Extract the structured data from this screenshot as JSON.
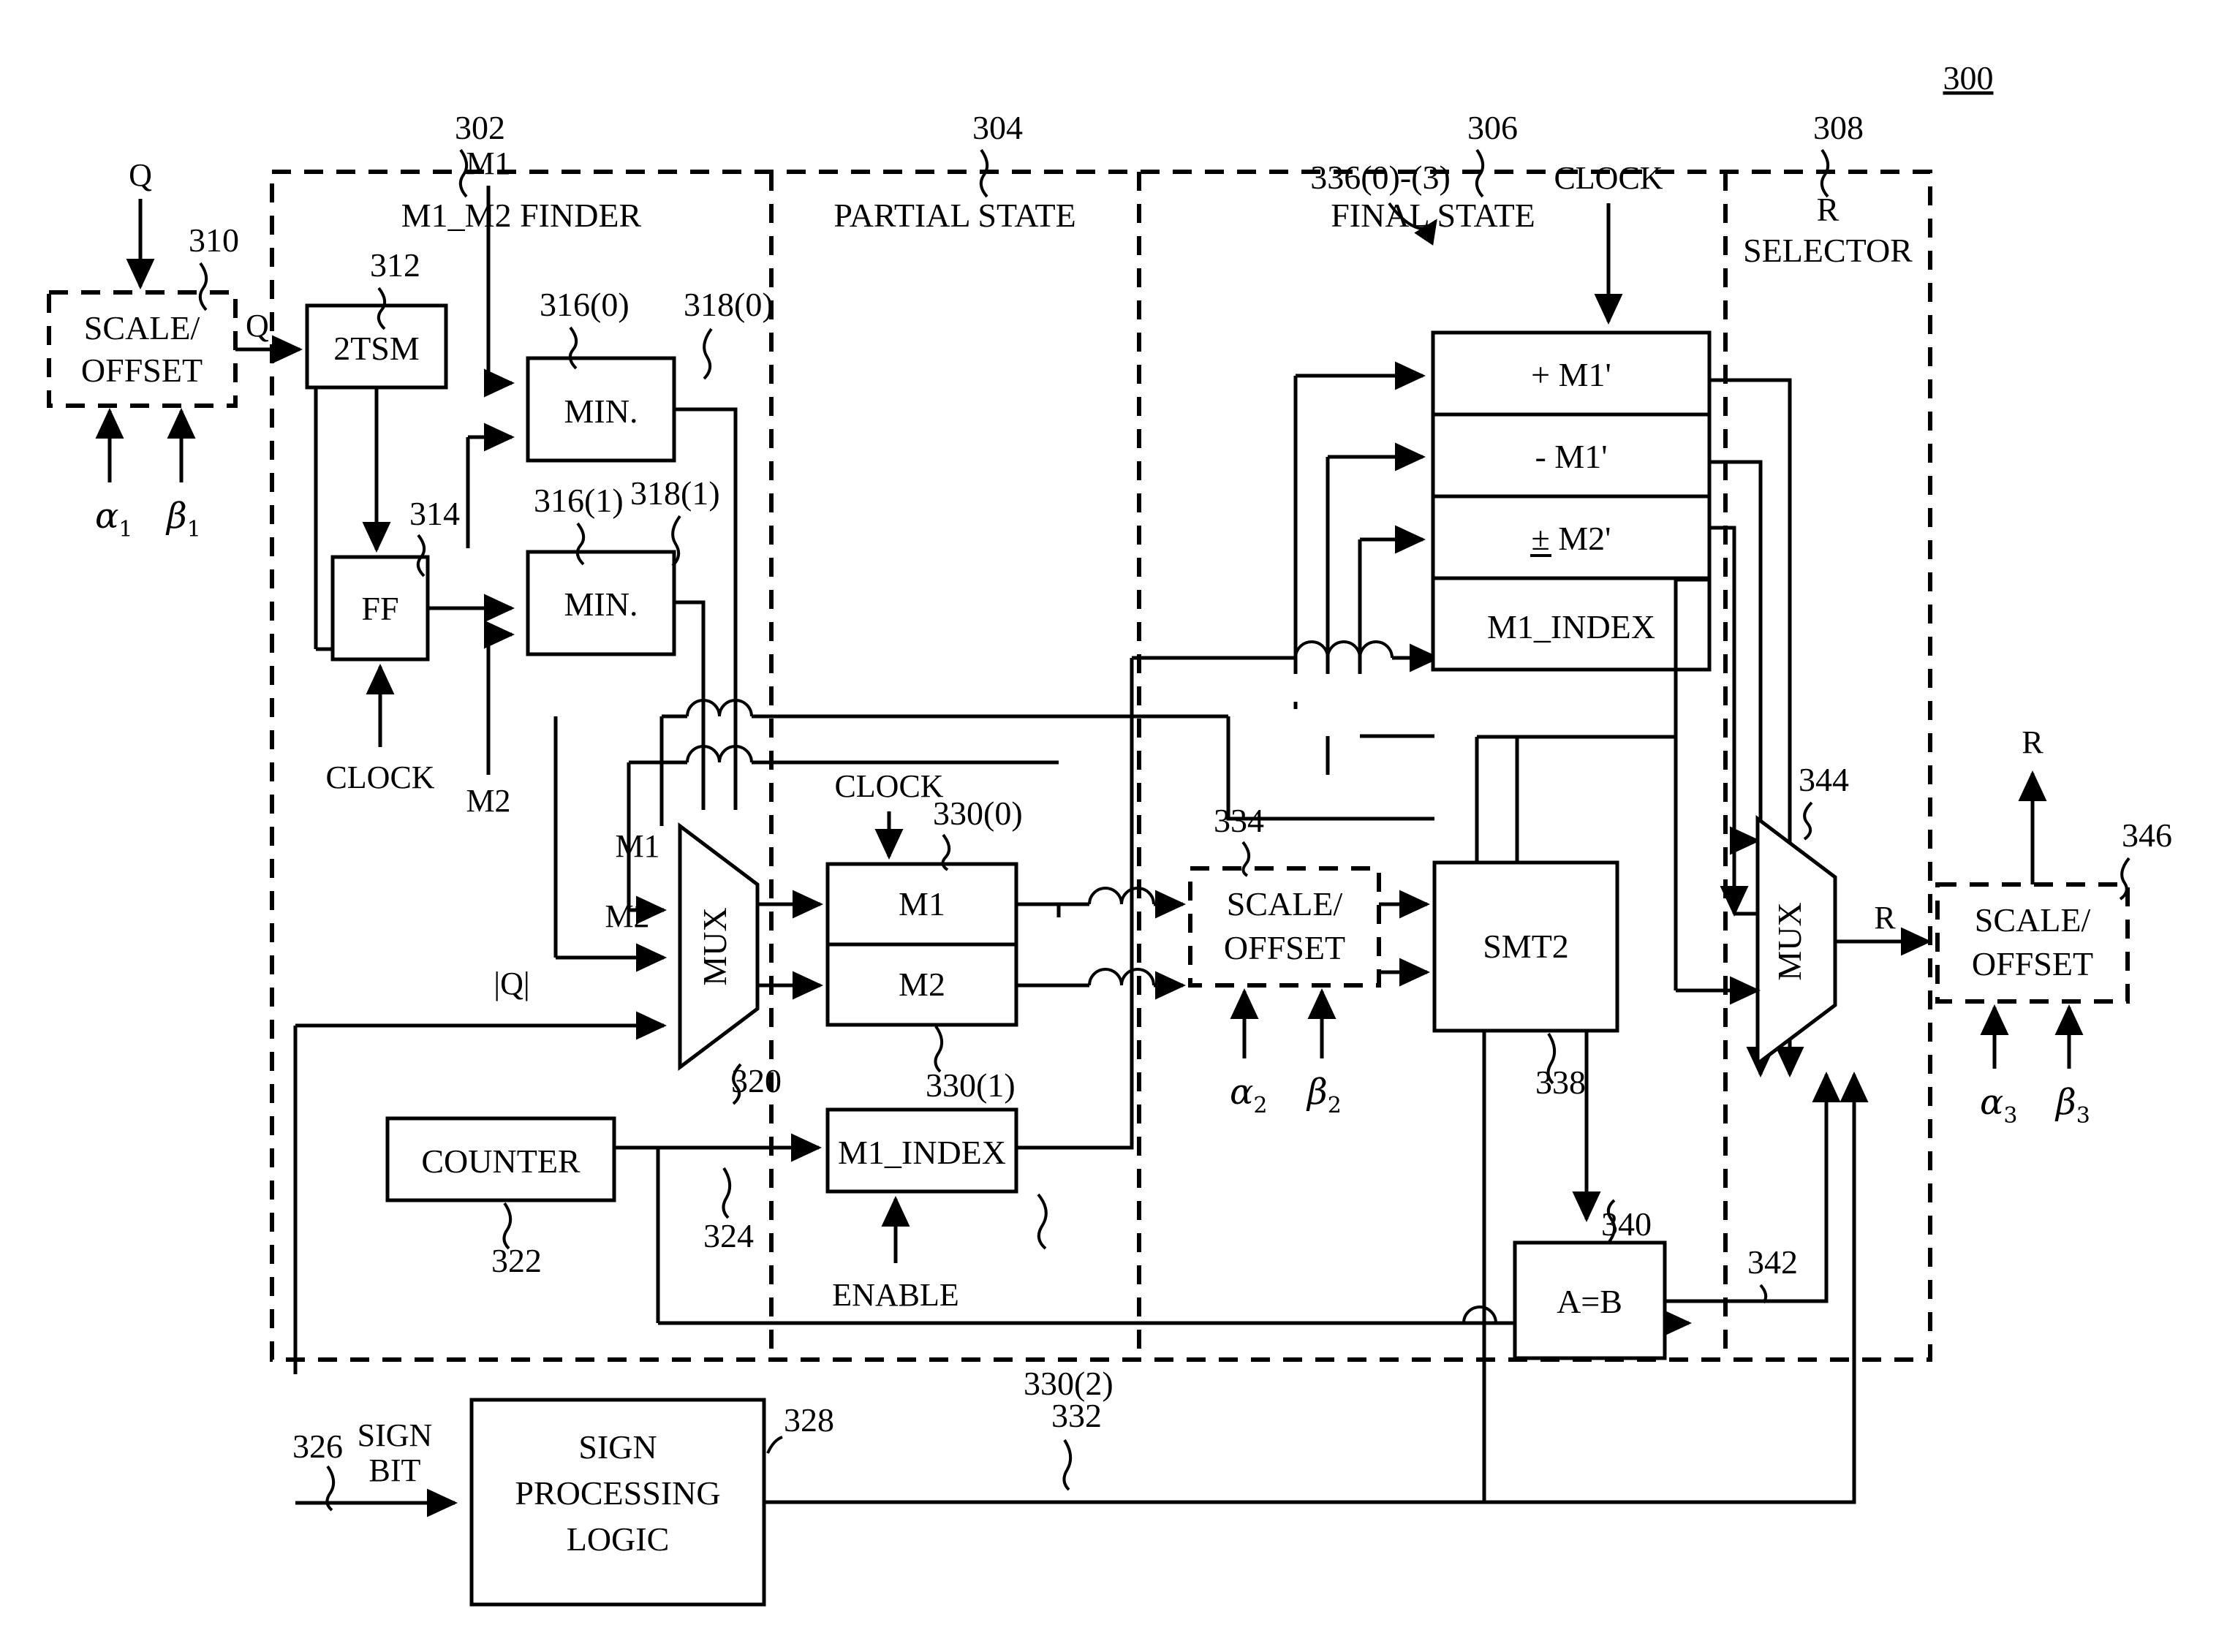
{
  "figure": {
    "number": "300"
  },
  "sections": [
    {
      "ref": "302",
      "title_line1": "M1_M2 FINDER",
      "title_line2": ""
    },
    {
      "ref": "304",
      "title_line1": "PARTIAL STATE",
      "title_line2": ""
    },
    {
      "ref": "306",
      "title_line1": "FINAL STATE",
      "title_line2": ""
    },
    {
      "ref": "308",
      "title_line1": "R",
      "title_line2": "SELECTOR"
    }
  ],
  "blocks": {
    "scale_offset_in": {
      "ref": "310",
      "line1": "SCALE/",
      "line2": "OFFSET"
    },
    "twotsm": {
      "ref": "312",
      "label": "2TSM"
    },
    "ff": {
      "ref": "314",
      "label": "FF"
    },
    "min0": {
      "ref": "316(0)",
      "label": "MIN.",
      "out_ref": "318(0)"
    },
    "min1": {
      "ref": "316(1)",
      "label": "MIN.",
      "out_ref": "318(1)"
    },
    "mux320": {
      "ref": "320",
      "label": "MUX"
    },
    "counter": {
      "ref": "322",
      "label": "COUNTER",
      "out_ref": "324"
    },
    "partial_m1": {
      "ref": "330(0)",
      "label": "M1"
    },
    "partial_m2": {
      "ref": "330(1)",
      "label": "M2"
    },
    "partial_index": {
      "ref": "330(2)",
      "label": "M1_INDEX"
    },
    "sign_logic": {
      "in_ref": "326",
      "out_ref": "328",
      "line1": "SIGN",
      "line2": "PROCESSING",
      "line3": "LOGIC",
      "wire_ref": "332"
    },
    "scale_offset_mid": {
      "ref": "334",
      "line1": "SCALE/",
      "line2": "OFFSET"
    },
    "final_regs": {
      "ref": "336(0)-(3)",
      "rows": [
        "+ M1'",
        "- M1'",
        "± M2'",
        "M1_INDEX"
      ]
    },
    "smt2": {
      "ref": "338",
      "label": "SMT2"
    },
    "aeqb": {
      "ref": "340",
      "label": "A=B",
      "out_ref": "342"
    },
    "mux344": {
      "ref": "344",
      "label": "MUX"
    },
    "scale_offset_out": {
      "ref": "346",
      "line1": "SCALE/",
      "line2": "OFFSET"
    }
  },
  "signals": {
    "q_in": "Q",
    "q_scaled": "Q",
    "abs_q": "|Q|",
    "m1": "M1",
    "m2": "M2",
    "clock": "CLOCK",
    "enable": "ENABLE",
    "sign_bit_l1": "SIGN",
    "sign_bit_l2": "BIT",
    "r_out": "R",
    "r_mux": "R",
    "alpha1": "α",
    "alpha1_sub": "1",
    "beta1": "β",
    "beta1_sub": "1",
    "alpha2": "α",
    "alpha2_sub": "2",
    "beta2": "β",
    "beta2_sub": "2",
    "alpha3": "α",
    "alpha3_sub": "3",
    "beta3": "β",
    "beta3_sub": "3"
  },
  "colors": {
    "ink": "#000000",
    "paper": "#ffffff"
  }
}
